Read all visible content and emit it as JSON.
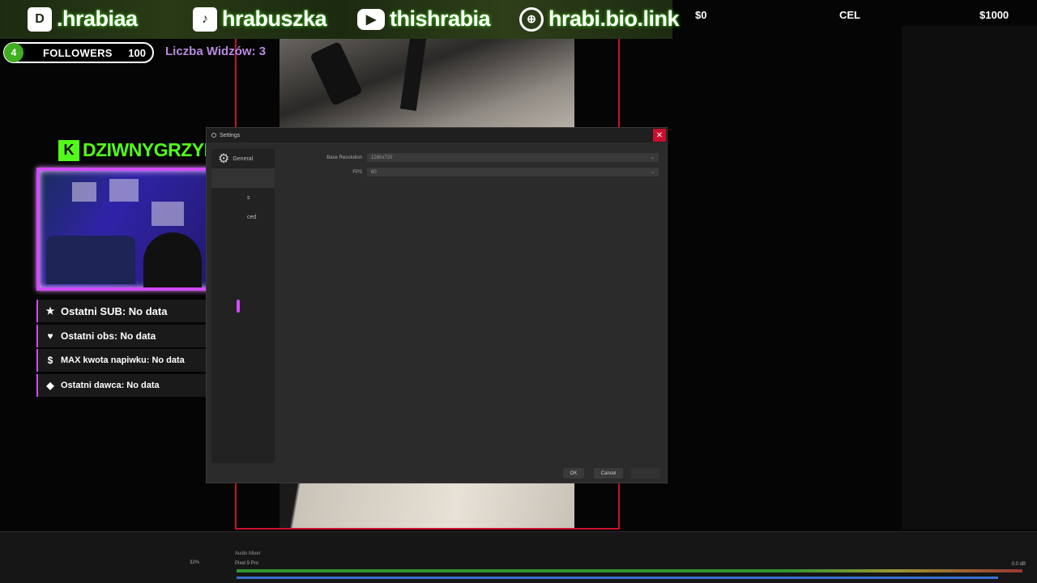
{
  "socials": [
    {
      "icon": "discord-icon",
      "glyph": "D",
      "handle": ".hrabiaa"
    },
    {
      "icon": "tiktok-icon",
      "glyph": "♪",
      "handle": "hrabuszka"
    },
    {
      "icon": "youtube-icon",
      "glyph": "▶",
      "handle": "thishrabia"
    },
    {
      "icon": "globe-icon",
      "glyph": "⊕",
      "handle": "hrabi.bio.link"
    }
  ],
  "goal": {
    "current": "$0",
    "label": "CEL",
    "target": "$1000"
  },
  "followers": {
    "count": "4",
    "label": "FOLLOWERS",
    "goal": "100"
  },
  "viewers": "Liczba Widzów: 3",
  "kick": {
    "glyph": "K",
    "username": "DZIWNYGRZYB"
  },
  "stats": [
    {
      "icon": "star-icon",
      "glyph": "★",
      "text": "Ostatni SUB: No data"
    },
    {
      "icon": "heart-icon",
      "glyph": "♥",
      "text": "Ostatni obs: No data"
    },
    {
      "icon": "dollar-icon",
      "glyph": "$",
      "text": "MAX kwota napiwku: No data"
    },
    {
      "icon": "diamond-icon",
      "glyph": "◆",
      "text": "Ostatni dawca: No data"
    }
  ],
  "settings": {
    "title": "Settings",
    "sidebar": {
      "general": "General",
      "item3": "s",
      "item4": "ced"
    },
    "base_resolution_label": "Base Resolution",
    "base_resolution_value": "1280x720",
    "fps_label": "FPS",
    "fps_value": "60",
    "ok": "OK",
    "cancel": "Cancel"
  },
  "obs": {
    "audio_mixer": "Audio Mixer",
    "device": "Pixel 9 Pro",
    "db": "0.0 dB",
    "zoom": "32%"
  },
  "colors": {
    "accent_red": "#c8102e",
    "kick_green": "#53fc18",
    "webcam_border": "#d14cff",
    "followers_green": "#3fae1f"
  }
}
